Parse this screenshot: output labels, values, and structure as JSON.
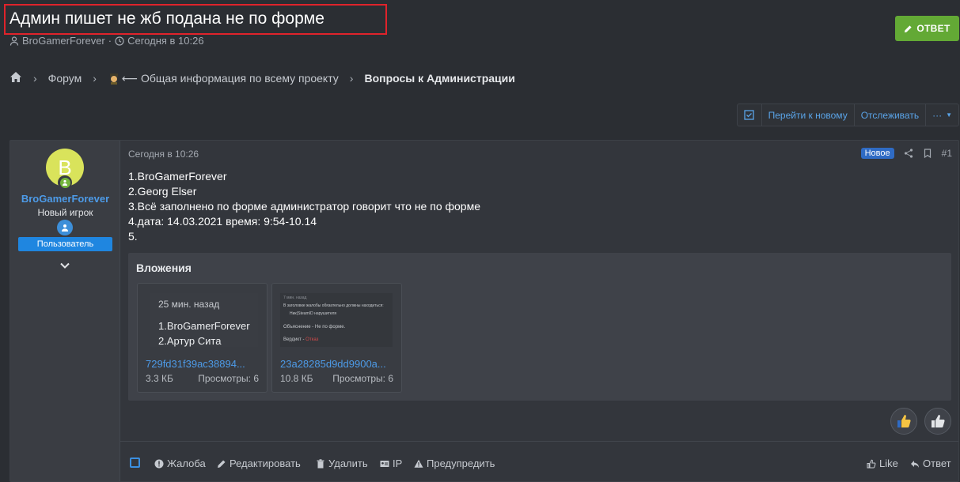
{
  "thread": {
    "title": "Админ пишет не жб подана не по форме",
    "author": "BroGamerForever",
    "separator": "·",
    "date": "Сегодня в 10:26",
    "reply_label": "ОТВЕТ"
  },
  "breadcrumbs": {
    "items": [
      "Форум",
      "Общая информация по всему проекту",
      "Вопросы к Администрации"
    ]
  },
  "toolbar": {
    "goto_new": "Перейти к новому",
    "watch": "Отслеживать",
    "more": "···"
  },
  "post": {
    "user": {
      "avatar_letter": "B",
      "name": "BroGamerForever",
      "title": "Новый игрок",
      "role": "Пользователь"
    },
    "date": "Сегодня в 10:26",
    "new_badge": "Новое",
    "number": "#1",
    "lines": [
      "1.BroGamerForever",
      "2.Georg Elser",
      "3.Всё заполнено по форме администратор говорит что не по форме",
      "4.дата: 14.03.2021 время: 9:54-10.14",
      "5."
    ],
    "attachments_title": "Вложения",
    "attachments": [
      {
        "thumb_lines": [
          "25 мин. назад",
          "1.BroGamerForever",
          "2.Артур Сита"
        ],
        "name": "729fd31f39ac38894...",
        "size": "3.3 КБ",
        "views": "Просмотры: 6"
      },
      {
        "thumb_lines": [
          "7 мин. назад",
          "В заголовке жалобы обязательно должны находиться:",
          "Ник(SteamID нарушителя",
          "Объяснение - Не по форме.",
          "Вердикт -",
          "Отказ"
        ],
        "name": "23a28285d9dd9900a...",
        "size": "10.8 КБ",
        "views": "Просмотры: 6"
      }
    ],
    "actions": {
      "report": "Жалоба",
      "edit": "Редактировать",
      "delete": "Удалить",
      "ip": "IP",
      "warn": "Предупредить",
      "like": "Like",
      "reply": "Ответ"
    }
  },
  "colors": {
    "accent": "#4d9be8",
    "reply_green": "#63a935",
    "highlight_red": "#e0232b",
    "role_blue": "#1f86e0"
  }
}
